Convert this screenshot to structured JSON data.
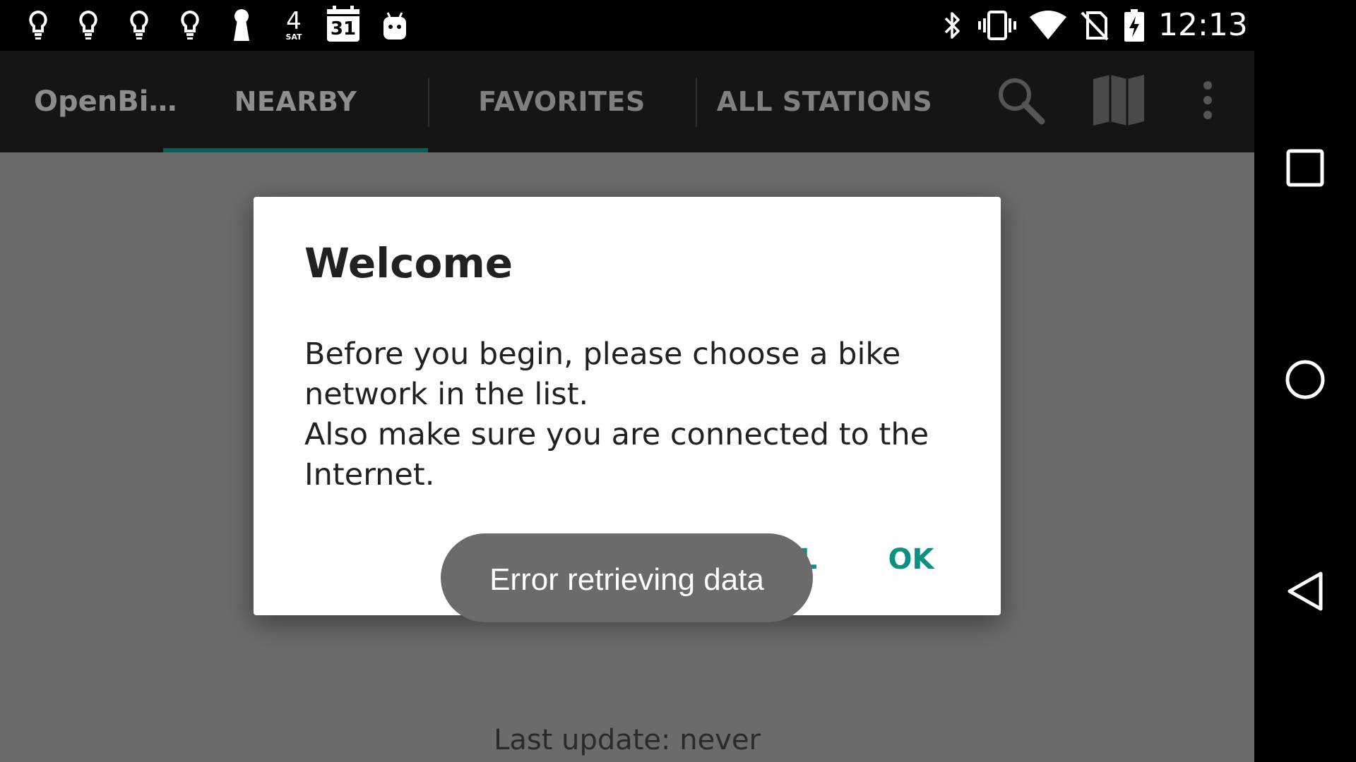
{
  "status_bar": {
    "time": "12:13",
    "calendar_day": "31",
    "weather_temp": "4",
    "weather_day": "SAT",
    "icons": [
      "lightbulb-icon",
      "lightbulb-icon",
      "lightbulb-icon",
      "lightbulb-icon",
      "keyhole-icon",
      "weather-icon",
      "calendar-icon",
      "android-icon",
      "bluetooth-icon",
      "vibrate-icon",
      "wifi-icon",
      "no-sim-icon",
      "battery-charging-icon"
    ]
  },
  "toolbar": {
    "app_title": "OpenBi…",
    "tabs": [
      {
        "label": "NEARBY",
        "selected": true
      },
      {
        "label": "FAVORITES",
        "selected": false
      },
      {
        "label": "ALL STATIONS",
        "selected": false
      }
    ],
    "actions": [
      "search-icon",
      "map-icon",
      "overflow-menu-icon"
    ]
  },
  "dialog": {
    "title": "Welcome",
    "message_line1": "Before you begin, please choose a bike network in the list.",
    "message_line2": "Also make sure you are connected to the Internet.",
    "cancel_label": "CANCEL",
    "ok_label": "OK"
  },
  "toast": {
    "text": "Error retrieving data"
  },
  "footer": {
    "last_update": "Last update: never"
  },
  "nav_bar": {
    "buttons": [
      "recents-square-icon",
      "home-circle-icon",
      "back-triangle-icon"
    ]
  },
  "colors": {
    "accent": "#0a9180",
    "tab_indicator": "#0d5d57",
    "toolbar_bg": "#151515",
    "scrim_bg": "#6b6b6b",
    "toast_bg": "#6b6b6b"
  }
}
